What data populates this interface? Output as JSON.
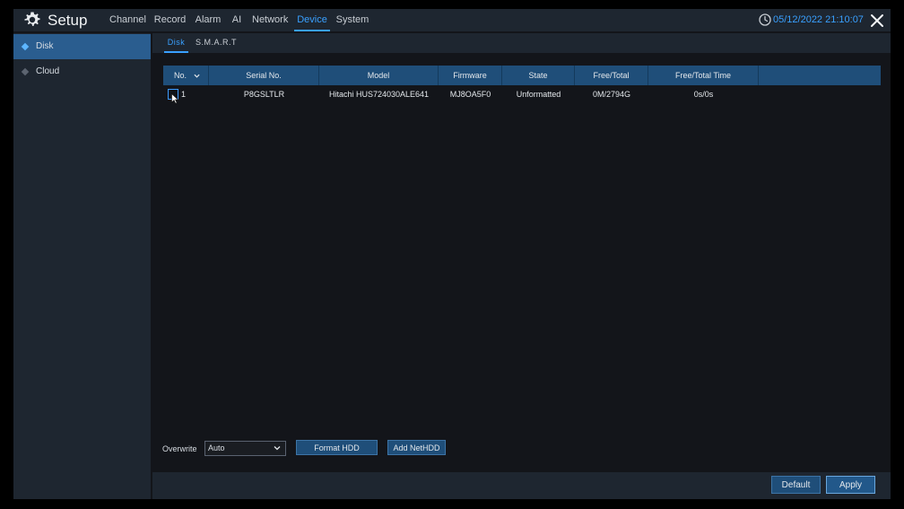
{
  "header": {
    "title": "Setup",
    "menu": [
      {
        "label": "Channel"
      },
      {
        "label": "Record"
      },
      {
        "label": "Alarm"
      },
      {
        "label": "AI"
      },
      {
        "label": "Network"
      },
      {
        "label": "Device"
      },
      {
        "label": "System"
      }
    ],
    "active_menu": "Device",
    "datetime": "05/12/2022 21:10:07",
    "accent_color": "#39a0ff"
  },
  "sidebar": {
    "items": [
      {
        "label": "Disk",
        "icon": "diamond-icon"
      },
      {
        "label": "Cloud",
        "icon": "diamond-icon"
      }
    ],
    "active_item": "Disk"
  },
  "subtabs": {
    "items": [
      {
        "label": "Disk"
      },
      {
        "label": "S.M.A.R.T"
      }
    ],
    "active": "Disk"
  },
  "table": {
    "columns": [
      "No.",
      "Serial No.",
      "Model",
      "Firmware",
      "State",
      "Free/Total",
      "Free/Total Time"
    ],
    "rows": [
      {
        "no": "1",
        "serial": "P8GSLTLR",
        "model": "Hitachi HUS724030ALE641",
        "firmware": "MJ8OA5F0",
        "state": "Unformatted",
        "free_total": "0M/2794G",
        "free_total_time": "0s/0s",
        "checked": false
      }
    ]
  },
  "controls": {
    "overwrite_label": "Overwrite",
    "overwrite_value": "Auto",
    "format_button": "Format HDD",
    "add_nethdd_button": "Add NetHDD"
  },
  "footer": {
    "default_button": "Default",
    "apply_button": "Apply"
  }
}
